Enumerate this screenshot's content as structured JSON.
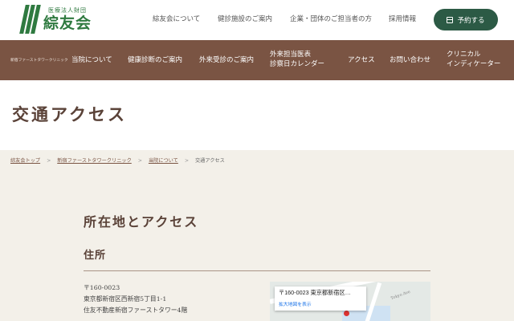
{
  "logo": {
    "sub": "医療法人財団",
    "main": "綜友会"
  },
  "top_nav": {
    "items": [
      "綜友会について",
      "健診施設のご案内",
      "企業・団体のご担当者の方",
      "採用情報"
    ],
    "reserve_label": "予約する"
  },
  "main_nav": {
    "clinic_name": "新宿ファーストタワークリニック",
    "items": [
      {
        "line1": "当院について",
        "line2": ""
      },
      {
        "line1": "健康診断のご案内",
        "line2": ""
      },
      {
        "line1": "外来受診のご案内",
        "line2": ""
      },
      {
        "line1": "外来担当医表",
        "line2": "診察日カレンダー"
      },
      {
        "line1": "アクセス",
        "line2": ""
      },
      {
        "line1": "お問い合わせ",
        "line2": ""
      },
      {
        "line1": "クリニカル",
        "line2": "インディケーター"
      }
    ]
  },
  "page": {
    "title": "交通アクセス"
  },
  "breadcrumb": [
    "綜友会トップ",
    "新宿ファーストタワークリニック",
    "当院について",
    "交通アクセス"
  ],
  "breadcrumb_sep": ">",
  "section": {
    "title": "所在地とアクセス",
    "subtitle": "住所"
  },
  "address": {
    "postal": "〒160-0023",
    "line1": "東京都新宿区西新宿5丁目1-1",
    "line2": "住友不動産新宿ファーストタワー4階"
  },
  "map": {
    "card_address": "〒160-0023 東京都新宿区…",
    "card_link": "拡大地図を表示",
    "street_label": "Tokyo Ave"
  },
  "colors": {
    "nav_brown": "#7a5443",
    "brand_green": "#2f7a40",
    "button_green": "#2c5a45",
    "content_bg": "#f3f0e9"
  }
}
